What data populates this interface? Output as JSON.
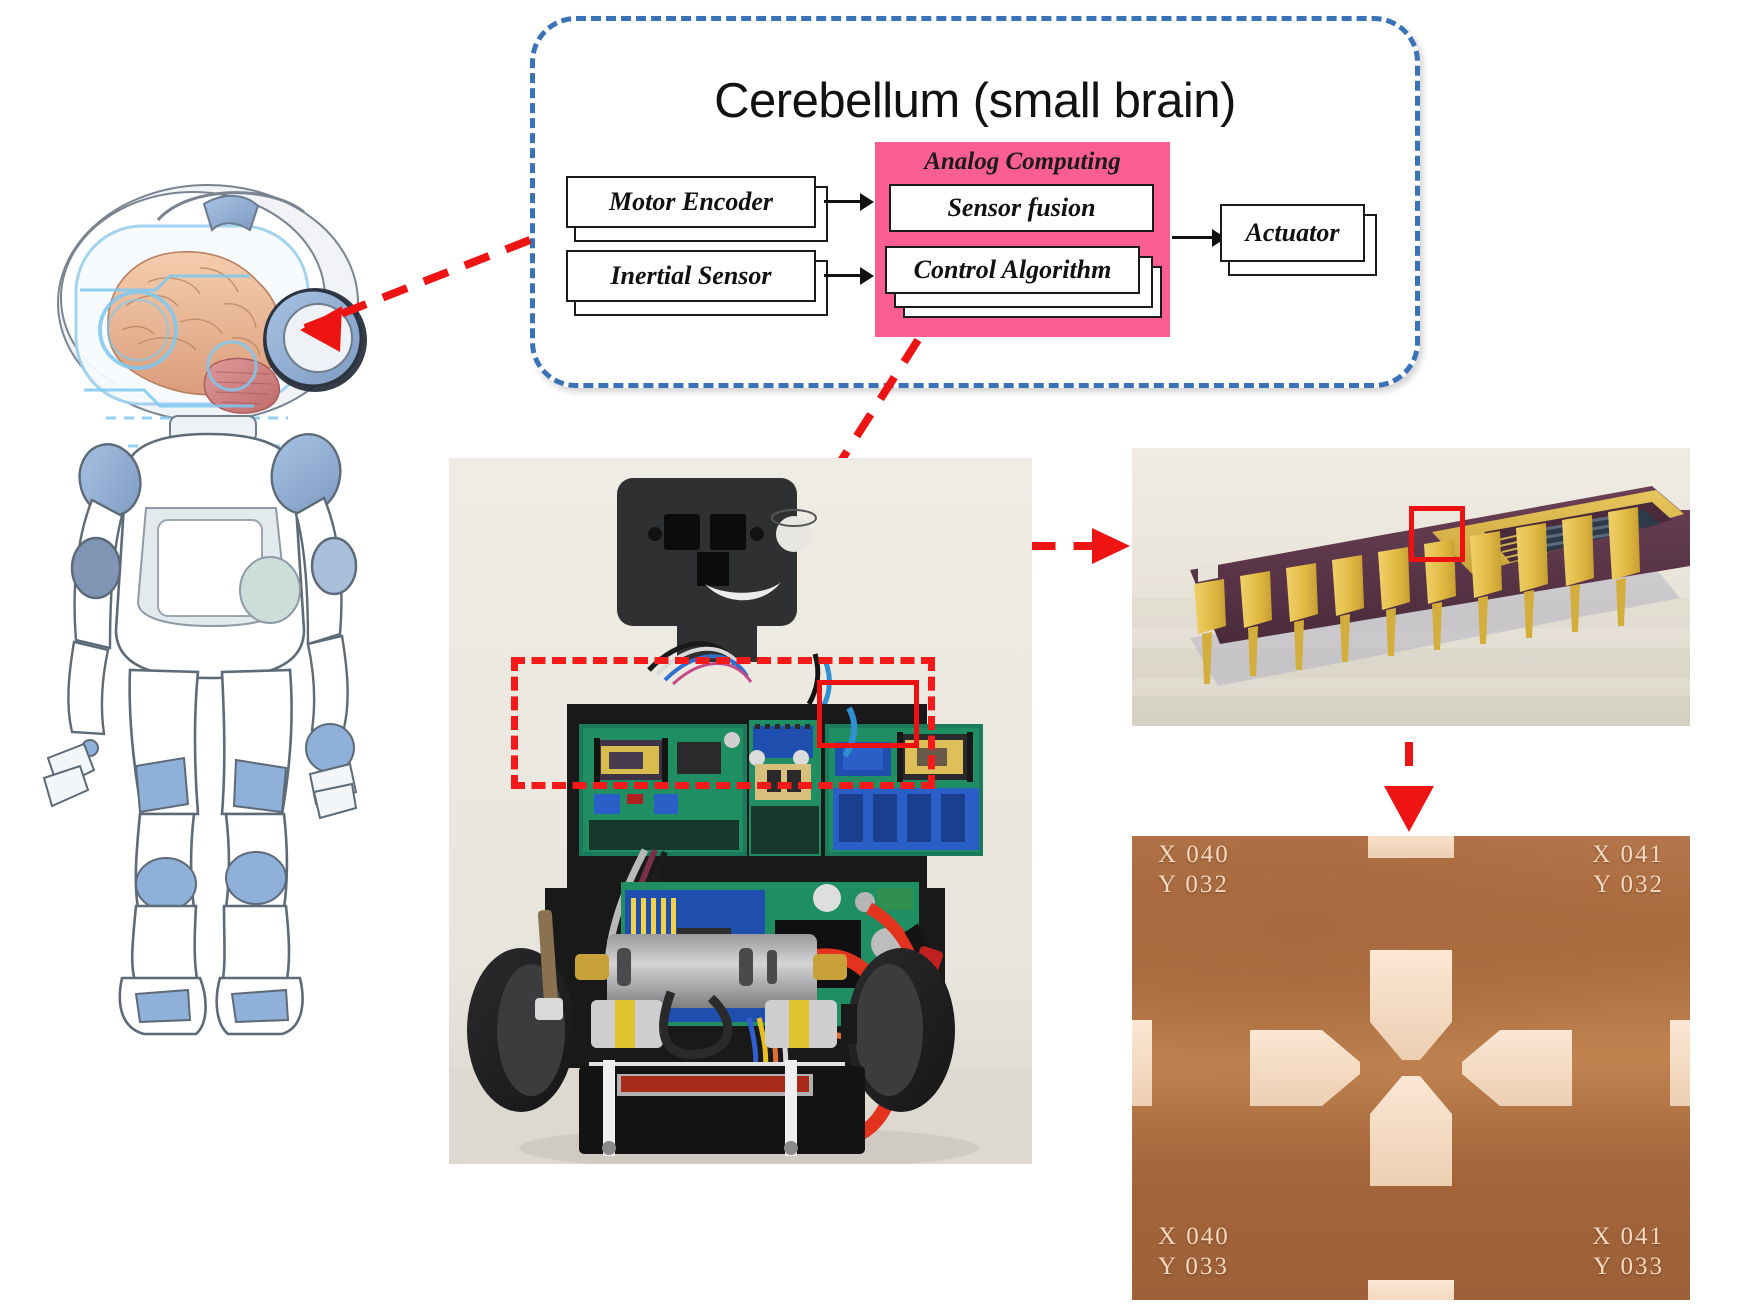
{
  "figure": {
    "type": "system-architecture-diagram",
    "description": "Cerebellum-inspired analog computing chip controlling a two-wheeled balancing robot"
  },
  "panel": {
    "title": "Cerebellum (small brain)",
    "border_color": "#3a72b8",
    "border_style": "dashed-rounded"
  },
  "blocks": {
    "inputs": [
      {
        "label": "Motor Encoder",
        "name": "motor-encoder"
      },
      {
        "label": "Inertial Sensor",
        "name": "inertial-sensor"
      }
    ],
    "analog": {
      "title": "Analog Computing",
      "fill_color": "#fb5e92",
      "items": [
        {
          "label": "Sensor fusion",
          "name": "sensor-fusion",
          "stacked": false
        },
        {
          "label": "Control Algorithm",
          "name": "control-algorithm",
          "stacked": true
        }
      ]
    },
    "output": {
      "label": "Actuator",
      "name": "actuator",
      "stacked": true
    }
  },
  "connectors": {
    "brain_to_panel": {
      "color": "#ee1414",
      "style": "dashed-arrow",
      "points_to": "brain-cerebellum"
    },
    "analog_to_board": {
      "color": "#ee1414",
      "style": "dashed",
      "points_to": "robot-control-board"
    },
    "board_to_chip": {
      "color": "#ee1414",
      "style": "dashed-arrow",
      "points_to": "chip-package"
    },
    "chip_to_micrograph": {
      "color": "#ee1414",
      "style": "dashed-arrow-down",
      "points_to": "micrograph"
    }
  },
  "robot_illustration": {
    "name": "humanoid-robot-with-brain-dome",
    "dome_label": "transparent-head-dome",
    "brain_label": "brain",
    "cerebellum_label": "cerebellum-highlight",
    "colors": {
      "body": "#ffffff",
      "accent": "#8fb0d8",
      "accent_dark": "#7e94b4",
      "outline": "#4c5663",
      "brain": "#e8b896",
      "cerebellum": "#cf8080",
      "hud": "#7ec9f2"
    }
  },
  "photos": {
    "robot": {
      "name": "two-wheel-balancing-robot-photo",
      "caption": "",
      "annotations": [
        {
          "name": "control-board-region",
          "style": "red-dashed-rect"
        },
        {
          "name": "analog-chip-on-board",
          "style": "red-solid-rect"
        }
      ]
    },
    "chip": {
      "name": "dip-package-chip-photo",
      "annotations": [
        {
          "name": "die-region",
          "style": "red-solid-rect"
        }
      ],
      "colors": {
        "package": "#5c3346",
        "pins": "#e8c24d",
        "lid": "#d7b34a"
      }
    },
    "micrograph": {
      "name": "die-micrograph",
      "background_color": "#ad6c40",
      "feature_color": "#f6dcc4",
      "corner_labels": [
        {
          "position": "top-left",
          "x": "X 040",
          "y": "Y 032"
        },
        {
          "position": "top-right",
          "x": "X 041",
          "y": "Y 032"
        },
        {
          "position": "bottom-left",
          "x": "X 040",
          "y": "Y 033"
        },
        {
          "position": "bottom-right",
          "x": "X 041",
          "y": "Y 033"
        }
      ]
    }
  }
}
